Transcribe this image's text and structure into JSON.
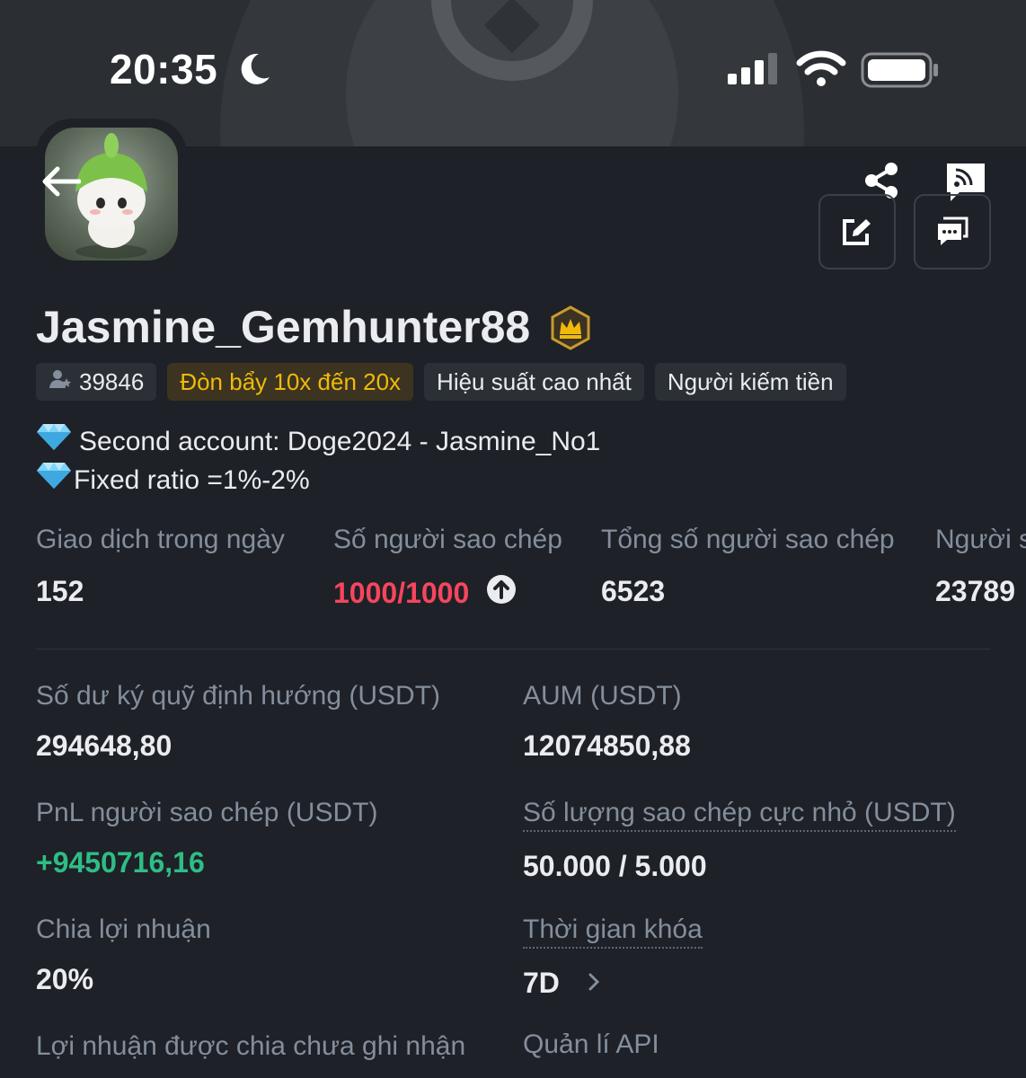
{
  "status_bar": {
    "time": "20:35"
  },
  "profile": {
    "name": "Jasmine_Gemhunter88",
    "tags": [
      {
        "label": "39846",
        "style": "count"
      },
      {
        "label": "Đòn bẩy 10x đến 20x",
        "style": "gold"
      },
      {
        "label": "Hiệu suất cao nhất",
        "style": "plain"
      },
      {
        "label": "Người kiếm tiền",
        "style": "plain"
      }
    ],
    "bio": [
      "Second account: Doge2024 - Jasmine_No1",
      "Fixed ratio =1%-2%"
    ]
  },
  "stats": [
    {
      "label": "Giao dịch trong ngày",
      "value": "152"
    },
    {
      "label": "Số người sao chép",
      "value": "1000/1000"
    },
    {
      "label": "Tổng số người sao chép",
      "value": "6523"
    },
    {
      "label": "Người s",
      "value": "23789"
    }
  ],
  "details": {
    "margin_balance": {
      "label": "Số dư ký quỹ định hướng (USDT)",
      "value": "294648,80"
    },
    "aum": {
      "label": "AUM (USDT)",
      "value": "12074850,88"
    },
    "copier_pnl": {
      "label": "PnL người sao chép (USDT)",
      "value": "+9450716,16"
    },
    "min_copy": {
      "label": "Số lượng sao chép cực nhỏ (USDT)",
      "value": "50.000 / 5.000"
    },
    "profit_share": {
      "label": "Chia lợi nhuận",
      "value": "20%"
    },
    "lock_time": {
      "label": "Thời gian khóa",
      "value": "7D"
    },
    "unrealized_share": {
      "label": "Lợi nhuận được chia chưa ghi nhận"
    },
    "api": {
      "label": "Quản lí API"
    }
  },
  "colors": {
    "background": "#1e2127",
    "accent_gold": "#f0b90b",
    "negative": "#f6465d",
    "positive": "#2ebd85",
    "muted_text": "#848e9c"
  }
}
